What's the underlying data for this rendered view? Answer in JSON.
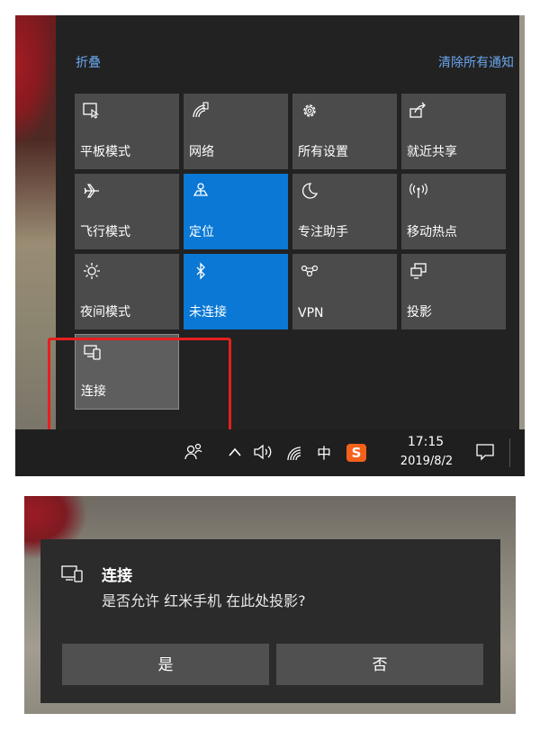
{
  "action_center": {
    "collapse_label": "折叠",
    "clear_all_label": "清除所有通知",
    "tiles": [
      {
        "label": "平板模式",
        "icon": "tablet-mode-icon",
        "active": false
      },
      {
        "label": "网络",
        "icon": "network-icon",
        "active": false
      },
      {
        "label": "所有设置",
        "icon": "gear-icon",
        "active": false
      },
      {
        "label": "就近共享",
        "icon": "nearby-share-icon",
        "active": false
      },
      {
        "label": "飞行模式",
        "icon": "airplane-icon",
        "active": false
      },
      {
        "label": "定位",
        "icon": "location-icon",
        "active": true
      },
      {
        "label": "专注助手",
        "icon": "moon-icon",
        "active": false
      },
      {
        "label": "移动热点",
        "icon": "hotspot-icon",
        "active": false
      },
      {
        "label": "夜间模式",
        "icon": "brightness-icon",
        "active": false
      },
      {
        "label": "未连接",
        "icon": "bluetooth-icon",
        "active": true
      },
      {
        "label": "VPN",
        "icon": "vpn-icon",
        "active": false
      },
      {
        "label": "投影",
        "icon": "project-icon",
        "active": false
      },
      {
        "label": "连接",
        "icon": "connect-icon",
        "active": false,
        "highlighted": true
      }
    ]
  },
  "taskbar": {
    "time": "17:15",
    "date": "2019/8/2",
    "input_language": "中",
    "ime_label": "S"
  },
  "dialog": {
    "title": "连接",
    "message": "是否允许 红米手机 在此处投影?",
    "yes_label": "是",
    "no_label": "否"
  },
  "colors": {
    "accent": "#0a78d4",
    "link": "#69a6ee",
    "highlight_box": "#e5201d",
    "tile": "#4b4b4b"
  }
}
